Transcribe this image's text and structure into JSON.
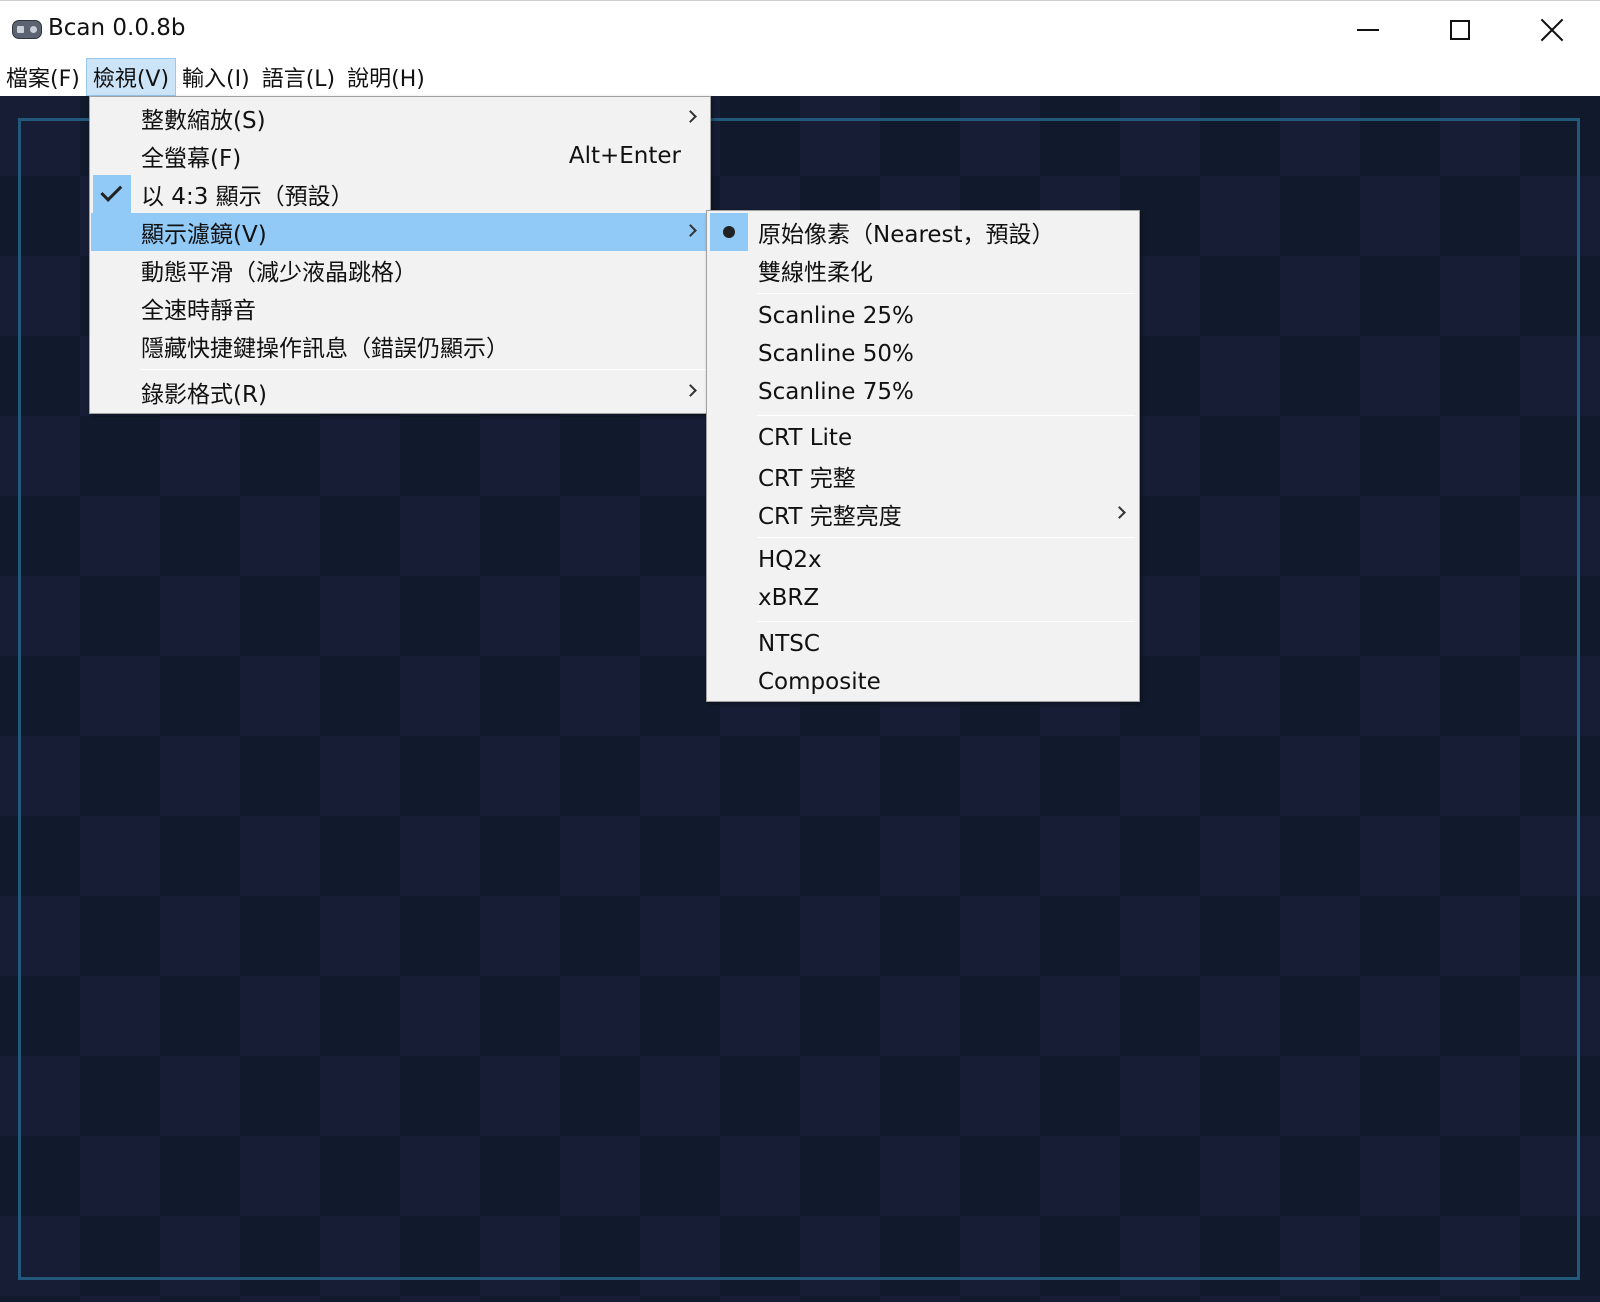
{
  "window": {
    "title": "Bcan 0.0.8b",
    "app_icon": "gamepad-icon",
    "controls": {
      "minimize": "minimize-icon",
      "maximize": "maximize-icon",
      "close": "close-icon"
    }
  },
  "menubar": {
    "items": [
      {
        "label": "檔案(F)"
      },
      {
        "label": "檢視(V)",
        "active": true
      },
      {
        "label": "輸入(I)"
      },
      {
        "label": "語言(L)"
      },
      {
        "label": "說明(H)"
      }
    ]
  },
  "view_menu": {
    "items": [
      {
        "label": "整數縮放(S)",
        "submenu": true
      },
      {
        "label": "全螢幕(F)",
        "shortcut": "Alt+Enter"
      },
      {
        "label": "以 4:3 顯示（預設）",
        "checked": true
      },
      {
        "label": "顯示濾鏡(V)",
        "submenu": true,
        "highlighted": true
      },
      {
        "label": "動態平滑（減少液晶跳格）"
      },
      {
        "label": "全速時靜音"
      },
      {
        "label": "隱藏快捷鍵操作訊息（錯誤仍顯示）"
      },
      {
        "label": "錄影格式(R)",
        "submenu": true
      }
    ]
  },
  "filter_menu": {
    "items": [
      {
        "label": "原始像素（Nearest，預設）",
        "selected": true
      },
      {
        "label": "雙線性柔化"
      },
      {
        "label": "Scanline 25%"
      },
      {
        "label": "Scanline 50%"
      },
      {
        "label": "Scanline 75%"
      },
      {
        "label": "CRT Lite"
      },
      {
        "label": "CRT 完整"
      },
      {
        "label": "CRT 完整亮度",
        "submenu": true
      },
      {
        "label": "HQ2x"
      },
      {
        "label": "xBRZ"
      },
      {
        "label": "NTSC"
      },
      {
        "label": "Composite"
      }
    ]
  },
  "colors": {
    "menu_highlight": "#91c9f7",
    "menubar_active": "#cce4f7",
    "client_bg": "#161d35",
    "frame_border": "#22587a"
  }
}
